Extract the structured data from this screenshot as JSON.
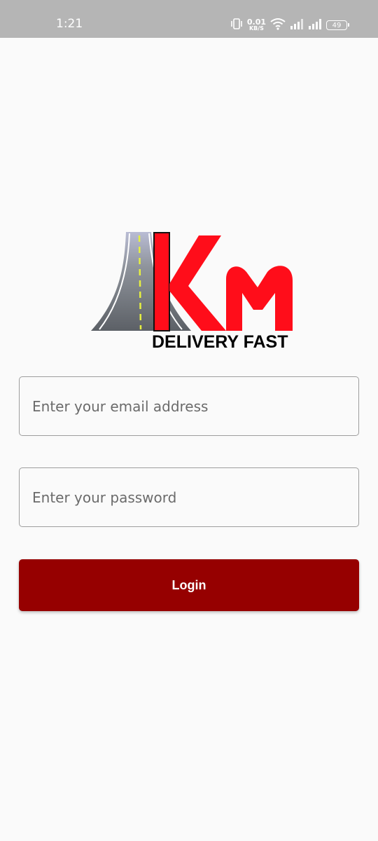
{
  "status_bar": {
    "time": "1:21",
    "net_speed_value": "0.01",
    "net_speed_unit": "KB/S",
    "battery_level": "49",
    "icons": [
      "vibrate-icon",
      "wifi-icon",
      "signal-icon",
      "signal-icon",
      "battery-icon"
    ]
  },
  "logo": {
    "mark": "Km",
    "tagline": "DELIVERY FAST"
  },
  "login_form": {
    "email_placeholder": "Enter your email address",
    "email_value": "",
    "password_placeholder": "Enter your password",
    "password_value": "",
    "login_label": "Login"
  },
  "colors": {
    "status_bar_bg": "#b5b5b5",
    "page_bg": "#fafafa",
    "login_button_bg": "#960000",
    "logo_red": "#ff0d1a",
    "field_border": "#9e9e9e"
  }
}
